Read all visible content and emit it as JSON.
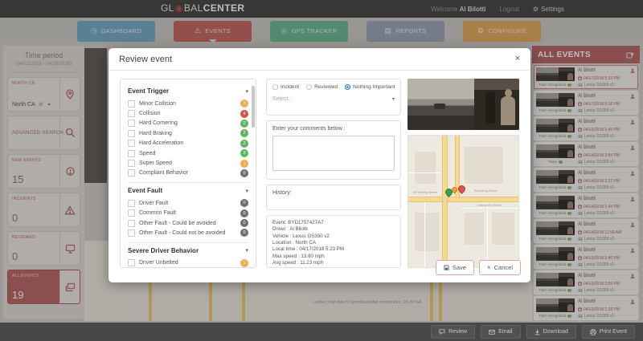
{
  "colors": {
    "accent": "#b25f5f",
    "badge_orange": "#efad4d",
    "badge_red": "#d9534f",
    "badge_green": "#5cb85c",
    "badge_gray": "#6f6f6f",
    "radio_selected": "#3779b7"
  },
  "icons": {
    "logo_o": "◉",
    "settings": "⚙",
    "caret": "▾",
    "clear": "⊗",
    "close": "×",
    "cancel_x": "×"
  },
  "header": {
    "logo_gl": "GL",
    "logo_bal": "BAL",
    "logo_center": "CENTER",
    "welcome": "Welcome",
    "user": "Al Bilotti",
    "logout": "Logout",
    "settings": "Settings"
  },
  "nav": {
    "tabs": [
      {
        "label": "DASHBOARD",
        "color": "#6ea7c6",
        "glyph": "◷",
        "active": false
      },
      {
        "label": "EVENTS",
        "color": "#c0605e",
        "glyph": "⚠",
        "active": true
      },
      {
        "label": "GPS TRACKER",
        "color": "#66b592",
        "glyph": "◎",
        "active": false
      },
      {
        "label": "REPORTS",
        "color": "#97a3b6",
        "glyph": "▤",
        "active": false
      },
      {
        "label": "CONFIGURE",
        "color": "#dfa659",
        "glyph": "⚙",
        "active": false
      }
    ]
  },
  "sidebar": {
    "time_period_label": "Time period",
    "time_period_value": "(04/12/2018 - 04/18/2018)",
    "region_label": "NORTH CA",
    "region_value": "North CA",
    "advanced_search_label": "ADVANCED SEARCH",
    "counters": [
      {
        "label": "NEW EVENTS",
        "value": "15"
      },
      {
        "label": "INCIDENTS",
        "value": "0"
      },
      {
        "label": "REVIEWED",
        "value": "0"
      },
      {
        "label": "ALL EVENTS",
        "value": "19",
        "active": true
      }
    ]
  },
  "modal": {
    "title": "Review event",
    "event_trigger": {
      "title": "Event Trigger",
      "items": [
        {
          "label": "Minor Collision",
          "count": "1",
          "color": "#efad4d"
        },
        {
          "label": "Collision",
          "count": "4",
          "color": "#d9534f"
        },
        {
          "label": "Hard Cornering",
          "count": "2",
          "color": "#5cb85c"
        },
        {
          "label": "Hard Braking",
          "count": "2",
          "color": "#5cb85c"
        },
        {
          "label": "Hard Acceleration",
          "count": "2",
          "color": "#5cb85c"
        },
        {
          "label": "Speed",
          "count": "2",
          "color": "#5cb85c"
        },
        {
          "label": "Super Speed",
          "count": "1",
          "color": "#efad4d"
        },
        {
          "label": "Compliant Behavior",
          "count": "0",
          "color": "#6f6f6f"
        }
      ]
    },
    "event_fault": {
      "title": "Event Fault",
      "items": [
        {
          "label": "Driver Fault",
          "count": "0",
          "color": "#6f6f6f"
        },
        {
          "label": "Common Fault",
          "count": "0",
          "color": "#6f6f6f"
        },
        {
          "label": "Other Fault - Could be avoided",
          "count": "0",
          "color": "#6f6f6f"
        },
        {
          "label": "Other Fault - Could not be avoided",
          "count": "0",
          "color": "#6f6f6f"
        }
      ]
    },
    "severe_behavior": {
      "title": "Severe Driver Behavior",
      "items": [
        {
          "label": "Driver Unbelted",
          "count": "1",
          "color": "#efad4d"
        }
      ]
    },
    "radios": [
      {
        "label": "Incident",
        "selected": false
      },
      {
        "label": "Reviewed",
        "selected": false
      },
      {
        "label": "Nothing Important",
        "selected": true
      }
    ],
    "select_placeholder": "Select...",
    "comments_label": "Enter your comments below :",
    "history_label": "History:",
    "details": [
      "Event: BYD1757427A7",
      "Driver : Al Bilotti",
      "Vehicle : Lexus GS350 v2",
      "Location : North CA",
      "Local time : 04/17/2018 5:23 PM",
      "Max speed : 13.80 mph",
      "Avg speed : 11.23 mph"
    ],
    "map_streets": [
      "Browning Street",
      "Datavalley Street",
      "W Sterling Street"
    ],
    "save_label": "Save",
    "cancel_label": "Cancel"
  },
  "events_panel": {
    "title": "ALL EVENTS",
    "driver": "Al Bilotti",
    "vehicle": "Lexus GS350 v2",
    "items": [
      {
        "time": "04/17/2018 5:23 PM",
        "face": "Face recognized",
        "selected": true
      },
      {
        "time": "04/17/2018 5:16 PM",
        "face": "Face recognized",
        "selected": false
      },
      {
        "time": "04/15/2018 1:45 PM",
        "face": "Face recognized",
        "selected": false
      },
      {
        "time": "04/14/2018 2:54 PM",
        "face": "Face",
        "selected": false
      },
      {
        "time": "04/14/2018 2:22 PM",
        "face": "Face recognized",
        "selected": false
      },
      {
        "time": "04/14/2018 1:44 PM",
        "face": "Face recognized",
        "selected": false
      },
      {
        "time": "04/14/2018 11:50 AM",
        "face": "Face recognized",
        "selected": false
      },
      {
        "time": "04/13/2018 2:40 PM",
        "face": "Face recognized",
        "selected": false
      },
      {
        "time": "04/13/2018 2:09 PM",
        "face": "Face recognized",
        "selected": false
      },
      {
        "time": "04/13/2018 1:28 PM",
        "face": "Face recognized",
        "selected": false
      }
    ]
  },
  "footer": {
    "buttons": [
      {
        "label": "Review"
      },
      {
        "label": "Email"
      },
      {
        "label": "Download"
      },
      {
        "label": "Print Event"
      }
    ]
  },
  "background": {
    "map_attribution": "Leaflet | Map data © OpenStreetMap contributors, CC-BY-SA"
  }
}
